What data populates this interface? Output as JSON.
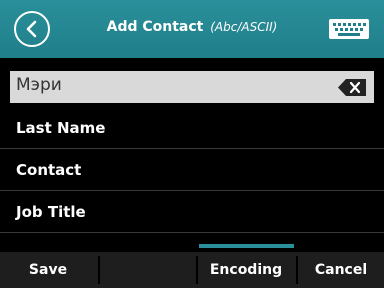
{
  "header": {
    "title": "Add Contact",
    "subtitle": "(Abc/ASCII)"
  },
  "input": {
    "value": "Мэри"
  },
  "list": {
    "items": [
      {
        "label": "Last Name"
      },
      {
        "label": "Contact"
      },
      {
        "label": "Job Title"
      }
    ]
  },
  "softkeys": {
    "save": "Save",
    "encoding": "Encoding",
    "cancel": "Cancel"
  },
  "colors": {
    "accent": "#2a8f9a",
    "background": "#000000"
  },
  "icons": {
    "back": "back-arrow-icon",
    "keyboard": "keyboard-icon",
    "backspace": "backspace-icon"
  }
}
